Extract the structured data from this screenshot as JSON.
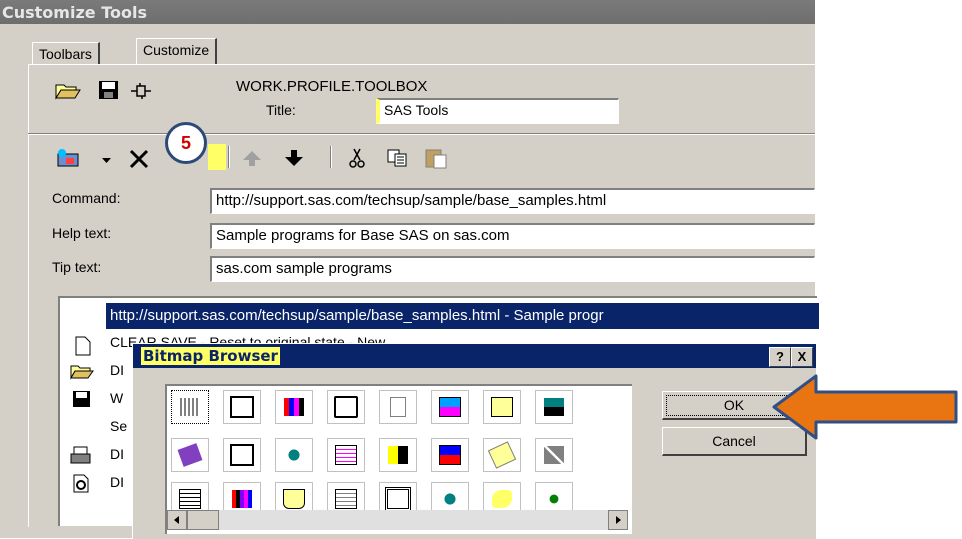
{
  "window": {
    "title": "Customize Tools"
  },
  "tabs": [
    {
      "label": "Toolbars"
    },
    {
      "label": "Customize"
    }
  ],
  "toolbox": {
    "name": "WORK.PROFILE.TOOLBOX",
    "title_label": "Title:",
    "title_value": "SAS Tools"
  },
  "step_badge": "5",
  "fields": {
    "command_label": "Command:",
    "command_value": "http://support.sas.com/techsup/sample/base_samples.html",
    "help_label": "Help text:",
    "help_value": "Sample programs for Base SAS on sas.com",
    "tip_label": "Tip text:",
    "tip_value": "sas.com sample programs"
  },
  "tool_list": {
    "selected": "http://support.sas.com/techsup/sample/base_samples.html - Sample progr",
    "rows": [
      "CLEAR SAVE - Reset to original state - New",
      "DI",
      "W",
      "Se",
      "DI",
      "DI"
    ]
  },
  "bitmap_browser": {
    "title": "Bitmap Browser",
    "help_btn": "?",
    "close_btn": "X",
    "ok_label": "OK",
    "cancel_label": "Cancel"
  },
  "colors": {
    "arrow": "#e87511",
    "arrow_border": "#2f4f86",
    "highlight": "#ffff66",
    "selection": "#0a246a"
  }
}
